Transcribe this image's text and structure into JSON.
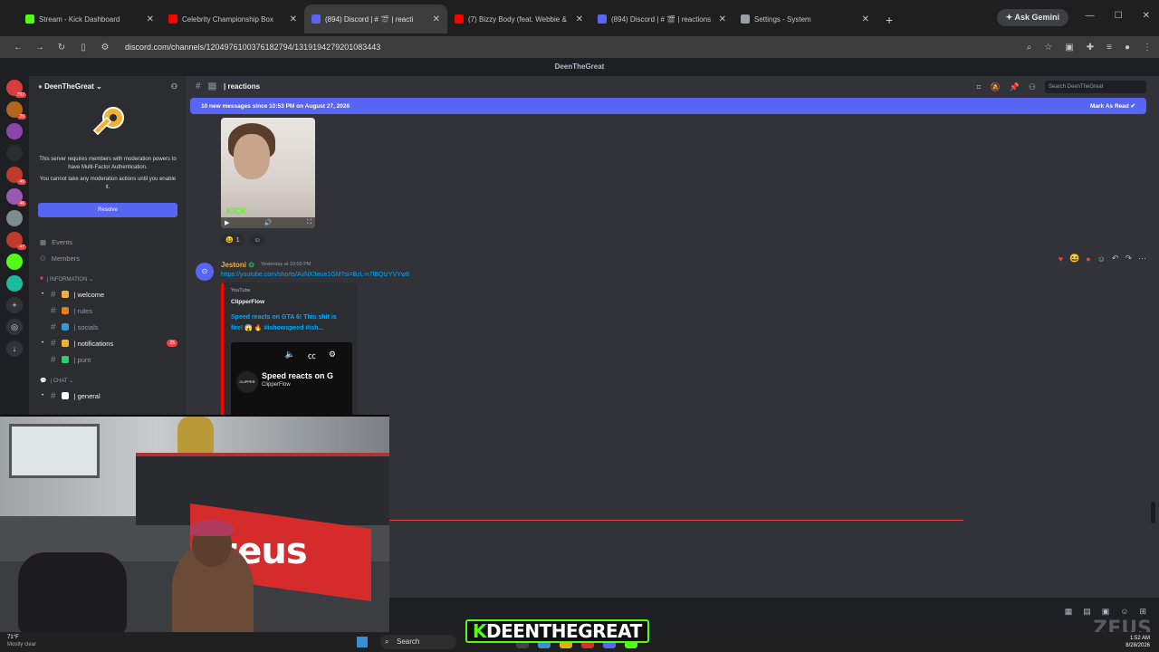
{
  "browser": {
    "tabs": [
      {
        "title": "Stream - Kick Dashboard",
        "color": "#53fc18"
      },
      {
        "title": "Celebrity Championship Box",
        "color": "#ff0000"
      },
      {
        "title": "(894) Discord | # 🎬 | reacti",
        "color": "#5865f2",
        "active": true
      },
      {
        "title": "(7) Bizzy Body (feat. Webbie & ",
        "color": "#ff0000"
      },
      {
        "title": "(894) Discord | # 🎬 | reactions",
        "color": "#5865f2"
      },
      {
        "title": "Settings - System",
        "color": "#9aa0a6"
      }
    ],
    "gemini": "Ask Gemini",
    "url": "discord.com/channels/1204976100376182794/1319194279201083443"
  },
  "discord": {
    "window_title": "DeenTheGreat",
    "guild_name": "DeenTheGreat",
    "mfa_text_1": "This server requires members with moderation powers to have Multi-Factor Authentication.",
    "mfa_text_2": "You cannot take any moderation actions until you enable it.",
    "resolve_label": "Resolve",
    "events_label": "Events",
    "members_label": "Members",
    "category_info": "| INFORMATION ⌄",
    "category_chat": "| CHAT ⌄",
    "channels": [
      {
        "name": "| welcome",
        "bright": true,
        "dot": true
      },
      {
        "name": "| rules",
        "bright": false,
        "dot": false
      },
      {
        "name": "| socials",
        "bright": false,
        "dot": false
      },
      {
        "name": "| notifications",
        "bright": true,
        "dot": true,
        "count": "25"
      },
      {
        "name": "| punt",
        "bright": false,
        "dot": false
      }
    ],
    "chat_channel": "| general",
    "server_badges": [
      "792",
      "29",
      "",
      "",
      "45",
      "46",
      "",
      "47",
      "",
      ""
    ],
    "current_channel": "| reactions",
    "search_placeholder": "Search DeenTheGreat",
    "new_messages": "10 new messages since 10:53 PM on August 27, 2026",
    "mark_as_read": "Mark As Read",
    "reaction_count": "1",
    "message": {
      "author": "Jestoni",
      "timestamp": "Yesterday at 10:00 PM",
      "link": "https://youtube.com/shorts/AvNX3eue1GM?si=BzL-n7lBQtzYVYw8",
      "embed_provider": "YouTube",
      "embed_author": "ClipperFlow",
      "embed_title": "Speed reacts on GTA 6! This shit is fire! 😱 🔥 #ishowspeed #ish...",
      "player_title": "Speed reacts on G",
      "player_channel": "ClipperFlow"
    }
  },
  "overlay": {
    "streamer_k": "K",
    "streamer_name": "DEENTHEGREAT",
    "banner_text": "zeus",
    "watermark": "ZEUS"
  },
  "taskbar": {
    "weather_temp": "71°F",
    "weather_desc": "Mostly clear",
    "search_label": "Search",
    "time": "1:52 AM",
    "date": "8/28/2026"
  }
}
